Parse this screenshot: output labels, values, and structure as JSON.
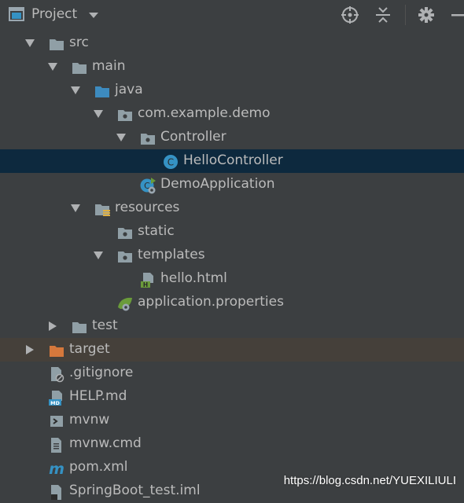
{
  "toolbar": {
    "title": "Project",
    "view_icon": "project-view-icon",
    "caret_icon": "dropdown-caret-icon",
    "buttons": [
      {
        "name": "locate-icon",
        "label": ""
      },
      {
        "name": "collapse-all-icon",
        "label": ""
      },
      {
        "name": "gear-icon",
        "label": ""
      },
      {
        "name": "hide-icon",
        "label": ""
      }
    ]
  },
  "tree": {
    "rows": [
      {
        "label": "src",
        "expanded": true,
        "icon": "folder-icon"
      },
      {
        "label": "main",
        "expanded": true,
        "icon": "folder-icon"
      },
      {
        "label": "java",
        "expanded": true,
        "icon": "source-folder-icon"
      },
      {
        "label": "com.example.demo",
        "expanded": true,
        "icon": "package-icon"
      },
      {
        "label": "Controller",
        "expanded": true,
        "icon": "package-icon"
      },
      {
        "label": "HelloController",
        "icon": "java-class-icon",
        "selected": true
      },
      {
        "label": "DemoApplication",
        "icon": "spring-boot-app-icon"
      },
      {
        "label": "resources",
        "expanded": true,
        "icon": "resources-folder-icon"
      },
      {
        "label": "static",
        "icon": "package-icon"
      },
      {
        "label": "templates",
        "expanded": true,
        "icon": "package-icon"
      },
      {
        "label": "hello.html",
        "icon": "html-file-icon"
      },
      {
        "label": "application.properties",
        "icon": "spring-properties-icon"
      },
      {
        "label": "test",
        "expanded": false,
        "icon": "folder-icon"
      },
      {
        "label": "target",
        "expanded": false,
        "icon": "excluded-folder-icon",
        "excluded": true
      },
      {
        "label": ".gitignore",
        "icon": "gitignore-file-icon"
      },
      {
        "label": "HELP.md",
        "icon": "markdown-file-icon"
      },
      {
        "label": "mvnw",
        "icon": "shell-script-icon"
      },
      {
        "label": "mvnw.cmd",
        "icon": "text-file-icon"
      },
      {
        "label": "pom.xml",
        "icon": "maven-icon"
      },
      {
        "label": "SpringBoot_test.iml",
        "icon": "iml-file-icon"
      }
    ]
  },
  "watermark": "https://blog.csdn.net/YUEXILIULI",
  "colors": {
    "background": "#3c3f41",
    "selection": "#0d293e",
    "excluded_row": "#45403a",
    "text": "#bbbbbb",
    "folder": "#909fa6",
    "source_folder": "#3d8bbf",
    "excluded_folder": "#d5783c",
    "class_icon": "#3592c4",
    "spring_green": "#6a9b3a"
  }
}
